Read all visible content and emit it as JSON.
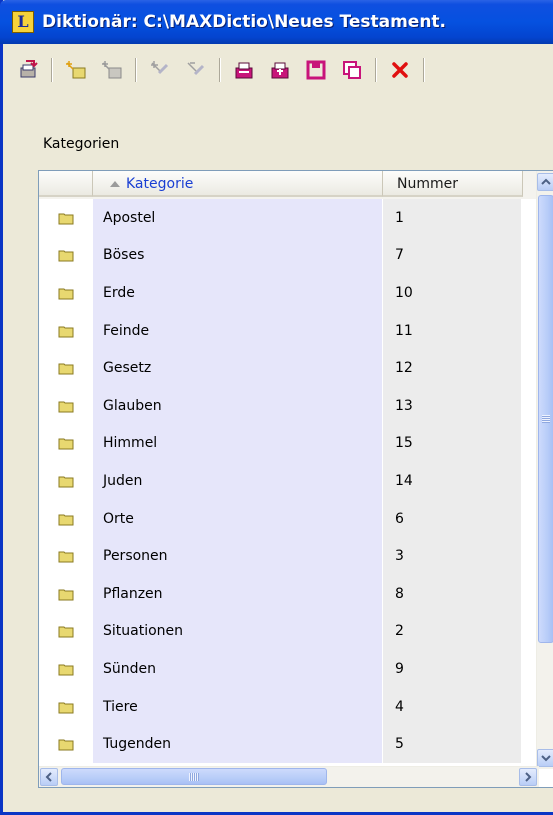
{
  "window": {
    "title": "Diktionär: C:\\MAXDictio\\Neues Testament.",
    "app_icon_letter": "L"
  },
  "toolbar": {
    "buttons": [
      {
        "icon": "new-category-icon"
      },
      {
        "icon": "add-entry-icon"
      },
      {
        "icon": "edit-entry-icon"
      },
      {
        "icon": "add-word-icon"
      },
      {
        "icon": "remove-word-icon"
      },
      {
        "icon": "open-icon"
      },
      {
        "icon": "import-icon"
      },
      {
        "icon": "save-icon"
      },
      {
        "icon": "copy-icon"
      },
      {
        "icon": "delete-icon"
      }
    ]
  },
  "group_label": "Kategorien",
  "table": {
    "columns": [
      "Kategorie",
      "Nummer"
    ],
    "sort_column": "Kategorie",
    "sort_direction": "ascending",
    "rows": [
      {
        "kategorie": "Apostel",
        "nummer": "1"
      },
      {
        "kategorie": "Böses",
        "nummer": "7"
      },
      {
        "kategorie": "Erde",
        "nummer": "10"
      },
      {
        "kategorie": "Feinde",
        "nummer": "11"
      },
      {
        "kategorie": "Gesetz",
        "nummer": "12"
      },
      {
        "kategorie": "Glauben",
        "nummer": "13"
      },
      {
        "kategorie": "Himmel",
        "nummer": "15"
      },
      {
        "kategorie": "Juden",
        "nummer": "14"
      },
      {
        "kategorie": "Orte",
        "nummer": "6"
      },
      {
        "kategorie": "Personen",
        "nummer": "3"
      },
      {
        "kategorie": "Pflanzen",
        "nummer": "8"
      },
      {
        "kategorie": "Situationen",
        "nummer": "2"
      },
      {
        "kategorie": "Sünden",
        "nummer": "9"
      },
      {
        "kategorie": "Tiere",
        "nummer": "4"
      },
      {
        "kategorie": "Tugenden",
        "nummer": "5"
      }
    ]
  },
  "colors": {
    "titlebar": "#0551e0",
    "kategorie_cell": "#e6e6fa",
    "nummer_cell": "#ececec",
    "folder": "#e8d870",
    "header_link": "#1a3fd3",
    "delete_red": "#e01010"
  }
}
